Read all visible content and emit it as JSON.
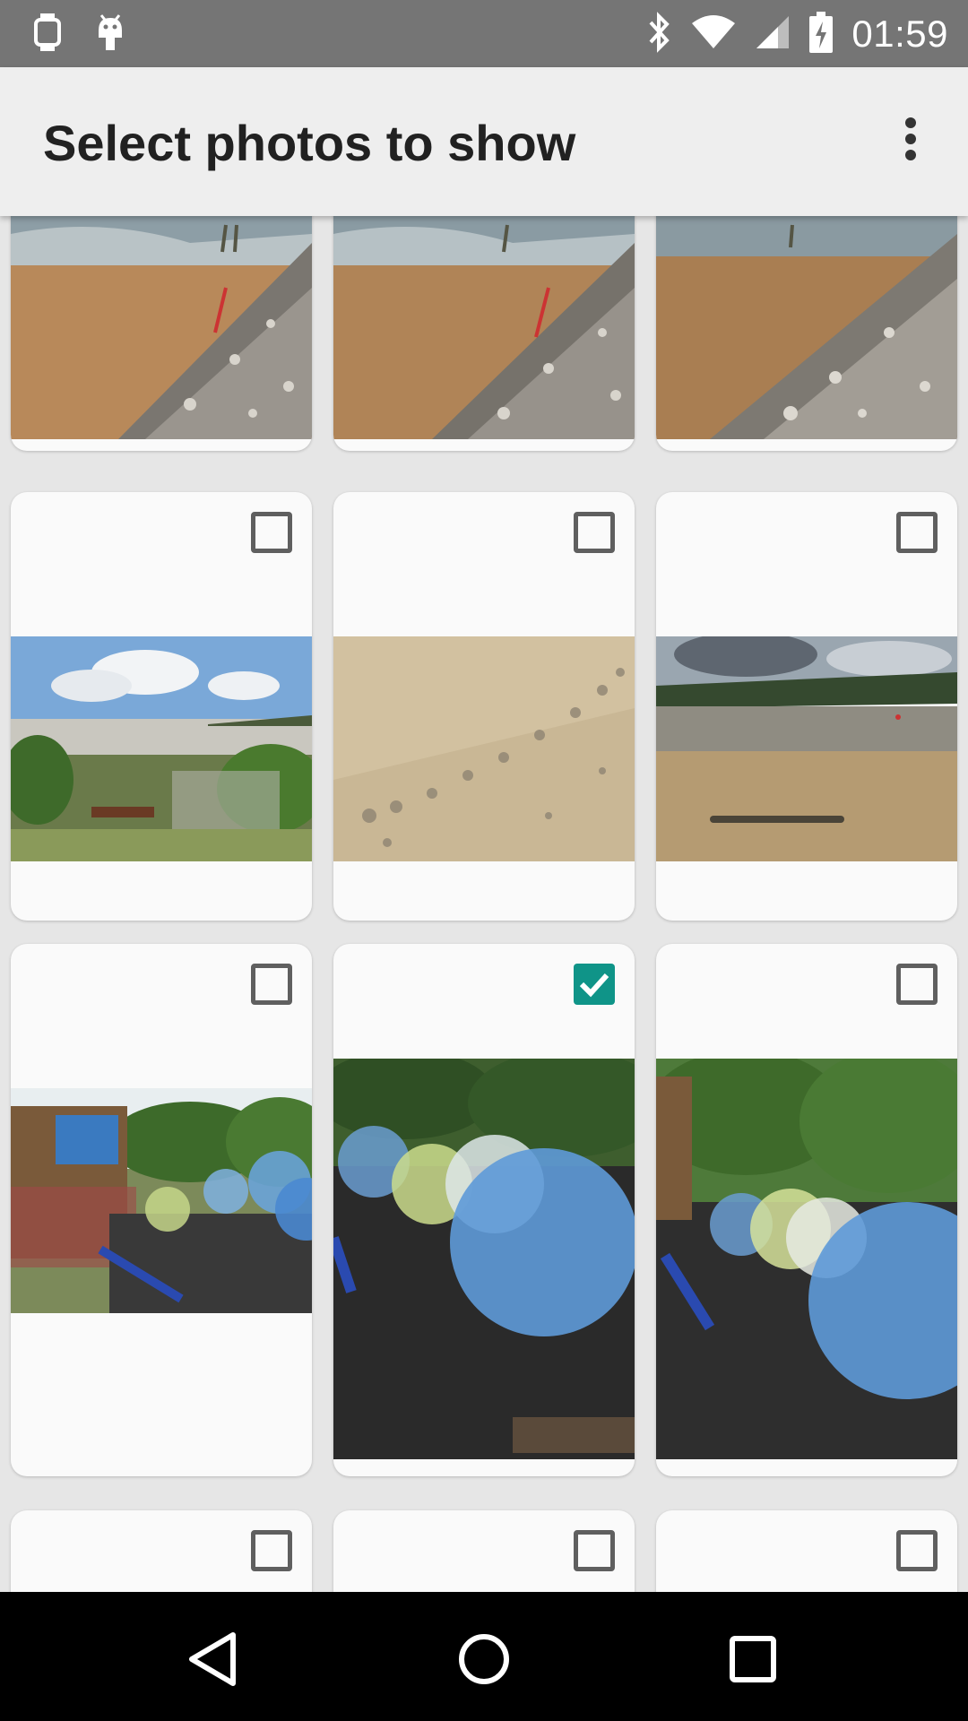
{
  "status_bar": {
    "time": "01:59",
    "left_icons": [
      "watch-icon",
      "android-icon"
    ],
    "right_icons": [
      "bluetooth-icon",
      "wifi-icon",
      "cell-signal-icon",
      "battery-charging-icon"
    ]
  },
  "app_bar": {
    "title": "Select photos to show",
    "overflow_icon": "more-vert-icon"
  },
  "photos": [
    {
      "row": 0,
      "col": 0,
      "subject": "beach-pebbles",
      "checked": null
    },
    {
      "row": 0,
      "col": 1,
      "subject": "beach-pebbles",
      "checked": null
    },
    {
      "row": 0,
      "col": 2,
      "subject": "beach-pebbles",
      "checked": null
    },
    {
      "row": 1,
      "col": 0,
      "subject": "beach-garden-view",
      "checked": false
    },
    {
      "row": 1,
      "col": 1,
      "subject": "sand-writing",
      "checked": false
    },
    {
      "row": 1,
      "col": 2,
      "subject": "beach-shore-writing",
      "checked": false
    },
    {
      "row": 2,
      "col": 0,
      "subject": "water-balls-crowd",
      "checked": false
    },
    {
      "row": 2,
      "col": 1,
      "subject": "water-balls-closeup",
      "checked": true
    },
    {
      "row": 2,
      "col": 2,
      "subject": "water-balls-trees",
      "checked": false
    },
    {
      "row": 3,
      "col": 0,
      "subject": "unknown",
      "checked": false
    },
    {
      "row": 3,
      "col": 1,
      "subject": "unknown",
      "checked": false
    },
    {
      "row": 3,
      "col": 2,
      "subject": "unknown",
      "checked": false
    }
  ],
  "colors": {
    "status_bar": "#757575",
    "app_bar": "#eeeeee",
    "checkbox_checked": "#0f9488",
    "nav_bar": "#000000"
  },
  "nav_bar": {
    "buttons": [
      "back-icon",
      "home-icon",
      "recents-icon"
    ]
  }
}
